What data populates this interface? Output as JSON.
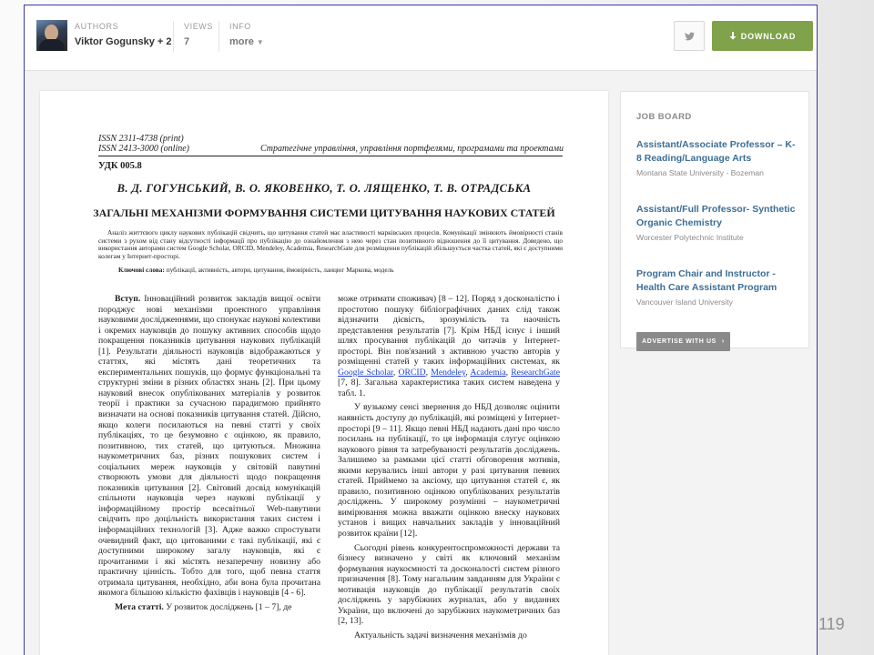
{
  "header": {
    "authors_label": "AUTHORS",
    "authors_value": "Viktor Gogunsky + 2",
    "views_label": "VIEWS",
    "views_value": "7",
    "info_label": "INFO",
    "info_value": "more",
    "download_label": "DOWNLOAD",
    "twitter_icon": "twitter-icon",
    "download_icon": "download-arrow-icon",
    "download_color": "#7fa24a"
  },
  "document": {
    "issn_print": "ISSN 2311-4738 (print)",
    "issn_online": "ISSN 2413-3000 (online)",
    "journal": "Стратегічне управління, управління портфелями, програмами та проектами",
    "udk": "УДК 005.8",
    "authors": "В. Д. ГОГУНСЬКИЙ, В. О. ЯКОВЕНКО, Т. О. ЛЯЩЕНКО, Т. В. ОТРАДСЬКА",
    "title": "ЗАГАЛЬНІ МЕХАНІЗМИ ФОРМУВАННЯ СИСТЕМИ ЦИТУВАННЯ НАУКОВИХ СТАТЕЙ",
    "abstract": "Аналіз життєвого циклу наукових публікацій свідчить, що цитування статей має властивості марківських процесів. Комунікації змінюють ймовірності станів системи з рухом від стану відсутності інформації про публікацію до ознайомлення з нею через стан позитивного відношення до її цитування. Доведено, що використання авторами систем Google Scholar, ORCID, Mendeley, Academia, ResearchGate для розміщення публікацій збільшується частка статей, які є доступними колегам у Інтернет-просторі.",
    "keywords_label": "Ключові слова:",
    "keywords": "публікації, активність, автори, цитування, ймовірність, ланцюг Маркова, модель",
    "intro_heading": "Вступ.",
    "intro_text": "Інноваційний розвиток закладів вищої освіти породжує нові механізми проектного управління науковими дослідженнями, що спонукає наукові колективи і окремих науковців до пошуку активних способів щодо покращення показників цитування наукових публікацій [1]. Результати діяльності науковців відображаються у статтях, які містять дані теоретичних та експериментальних пошуків, що формує функціональні та структурні зміни в різних областях знань [2]. При цьому науковий внесок опублікованих матеріалів у розвиток теорії і практики за сучасною парадигмою прийнято визначати на основі показників цитування статей. Дійсно, якщо колеги посилаються на певні статті у своїх публікаціях, то це безумовно є оцінкою, як правило, позитивною, тих статей, що цитуються. Множина наукометричних баз, різних пошукових систем і соціальних мереж науковців у світовій павутині створюють умови для діяльності щодо покращення показників цитування [2]. Світовий досвід комунікацій спільноти науковців через наукові публікації у інформаційному простір всесвітньої Web-павутини свідчить про доцільність використання таких систем і інформаційних технологій [3]. Адже важко спростувати очевидний факт, що цитованими є такі публікації, які є доступними широкому загалу науковців, які є прочитаними і які містять незаперечну новизну або практичну цінність. Тобто для того, щоб певна стаття отримала цитування, необхідно, аби вона була прочитана якомога більшою кількістю фахівців і науковців [4 - 6].",
    "goal_heading": "Мета статті.",
    "goal_text": "У розвиток досліджень [1 – 7], де",
    "right_p1_a": "може отримати споживач) [8 – 12]. Поряд з досконалістю і простотою пошуку бібліографічних даних слід також відзначити дієвість, зрозумілість та наочність представлення результатів [7]. Крім НБД існує і інший шлях просування публікацій до читачів у Інтернет-просторі. Він пов'язаний з активною участю авторів у розміщенні статей у таких інформаційних системах, як",
    "link_google": "Google Scholar",
    "link_orcid": "ORCID",
    "link_mendeley": "Mendeley",
    "link_academia": "Academia",
    "link_researchgate": "ResearchGate",
    "right_p1_b": "[7, 8]. Загальна характеристика таких систем наведена у табл. 1.",
    "right_p2": "У вузькому сенсі звернення до НБД дозволяє оцінити наявність доступу до публікацій, які розміщені у Інтернет-просторі [9 – 11]. Якщо певні НБД надають дані про число посилань на публікації, то ця інформація слугує оцінкою наукового рівня та затребуваності результатів досліджень. Залишимо за рамками цієї статті обговорення мотивів, якими керувались інші автори у разі цитування певних статей. Приймемо за аксіому, що цитування статей є, як правило, позитивною оцінкою опублікованих результатів досліджень. У широкому розумінні – наукометричні вимірювання можна вважати оцінкою внеску наукових установ і вищих навчальних закладів у інноваційний розвиток країни [12].",
    "right_p3": "Сьогодні рівень конкурентоспроможності держави та бізнесу визначено у світі як ключовий механізм формування наукоємності та досконалості систем різного призначення [8]. Тому нагальним завданням для України є мотивація науковців до публікації результатів своїх досліджень у зарубіжних журналах, або у виданнях України, що включені до зарубіжних наукометричних баз [2, 13].",
    "right_p4": "Актуальність задачі визначення механізмів до"
  },
  "jobboard": {
    "title": "JOB BOARD",
    "jobs": [
      {
        "title": "Assistant/Associate Professor – K-8 Reading/Language Arts",
        "org": "Montana State University - Bozeman"
      },
      {
        "title": "Assistant/Full Professor- Synthetic Organic Chemistry",
        "org": "Worcester Polytechnic Institute"
      },
      {
        "title": "Program Chair and Instructor - Health Care Assistant Program",
        "org": "Vancouver Island University"
      }
    ],
    "advertise_label": "ADVERTISE WITH US",
    "link_color": "#3d6e96"
  },
  "slide_number": "119"
}
